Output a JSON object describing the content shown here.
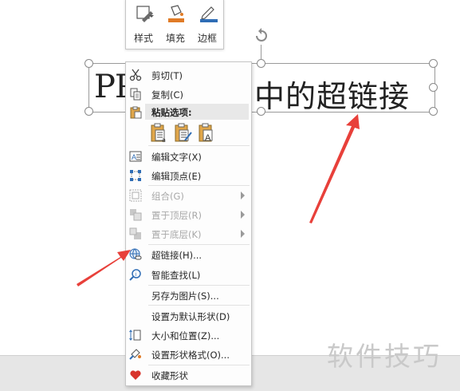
{
  "mini_toolbar": {
    "buttons": [
      {
        "label": "样式",
        "icon": "style-icon"
      },
      {
        "label": "填充",
        "icon": "fill-bucket-icon"
      },
      {
        "label": "边框",
        "icon": "border-pen-icon"
      }
    ]
  },
  "slide": {
    "text_left": "PP",
    "text_right": "中的超链接"
  },
  "context_menu": {
    "cut": "剪切(T)",
    "copy": "复制(C)",
    "paste_options": "粘贴选项:",
    "paste_icons": [
      "paste-use-destination-icon",
      "paste-keep-source-icon",
      "paste-text-only-icon"
    ],
    "edit_text": "编辑文字(X)",
    "edit_points": "编辑顶点(E)",
    "group": "组合(G)",
    "bring_to_front": "置于顶层(R)",
    "send_to_back": "置于底层(K)",
    "hyperlink": "超链接(H)...",
    "smart_lookup": "智能查找(L)",
    "save_as_picture": "另存为图片(S)...",
    "set_default_shape": "设置为默认形状(D)",
    "size_and_position": "大小和位置(Z)...",
    "format_shape": "设置形状格式(O)...",
    "favorite_shape": "收藏形状"
  },
  "watermark": "软件技巧",
  "colors": {
    "arrow_red": "#e8403a",
    "fill_orange": "#e07b26",
    "border_blue": "#2f6db5",
    "heart_red": "#d8342c"
  }
}
